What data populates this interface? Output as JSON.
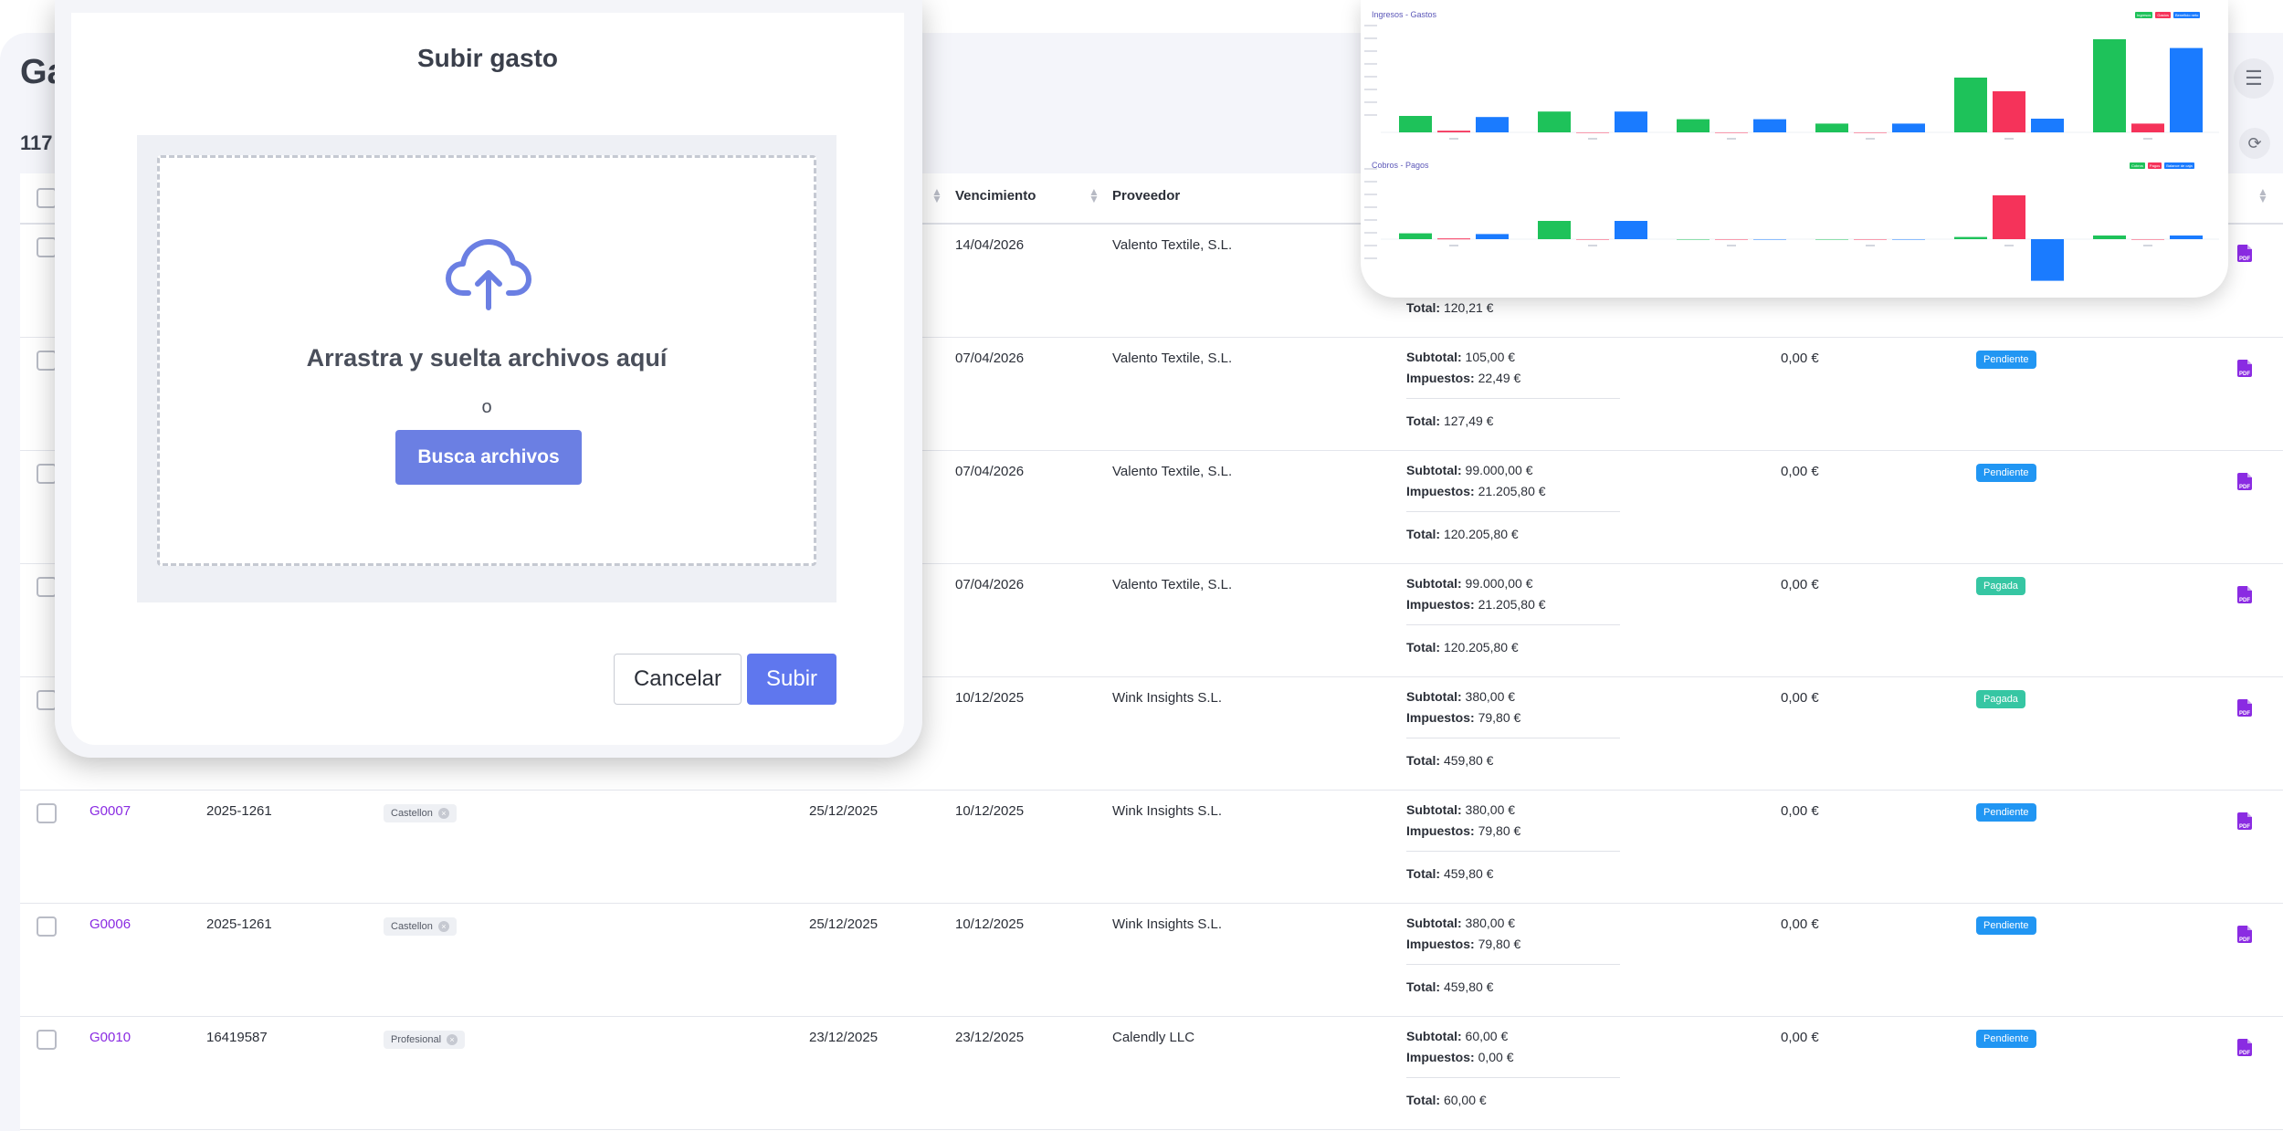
{
  "page": {
    "title": "Ga",
    "count": "117"
  },
  "table": {
    "headers": {
      "vencimiento": "Vencimiento",
      "proveedor": "Proveedor"
    },
    "rows": [
      {
        "code": "",
        "num": "",
        "tag": "",
        "fecha": "",
        "venc": "14/04/2026",
        "prov": "Valento Textile, S.L.",
        "subtotal": "",
        "impuestos": "",
        "total": "120,21 €",
        "pagado": "",
        "estado": "",
        "estado_type": ""
      },
      {
        "code": "",
        "num": "",
        "tag": "",
        "fecha": "",
        "venc": "07/04/2026",
        "prov": "Valento Textile, S.L.",
        "subtotal": "105,00 €",
        "impuestos": "22,49 €",
        "total": "127,49 €",
        "pagado": "0,00 €",
        "estado": "Pendiente",
        "estado_type": "pend"
      },
      {
        "code": "",
        "num": "",
        "tag": "",
        "fecha": "",
        "venc": "07/04/2026",
        "prov": "Valento Textile, S.L.",
        "subtotal": "99.000,00 €",
        "impuestos": "21.205,80 €",
        "total": "120.205,80 €",
        "pagado": "0,00 €",
        "estado": "Pendiente",
        "estado_type": "pend"
      },
      {
        "code": "",
        "num": "",
        "tag": "",
        "fecha": "",
        "venc": "07/04/2026",
        "prov": "Valento Textile, S.L.",
        "subtotal": "99.000,00 €",
        "impuestos": "21.205,80 €",
        "total": "120.205,80 €",
        "pagado": "0,00 €",
        "estado": "Pagada",
        "estado_type": "paid"
      },
      {
        "code": "",
        "num": "",
        "tag": "",
        "fecha": "",
        "venc": "10/12/2025",
        "prov": "Wink Insights S.L.",
        "subtotal": "380,00 €",
        "impuestos": "79,80 €",
        "total": "459,80 €",
        "pagado": "0,00 €",
        "estado": "Pagada",
        "estado_type": "paid"
      },
      {
        "code": "G0007",
        "num": "2025-1261",
        "tag": "Castellon",
        "fecha": "25/12/2025",
        "venc": "10/12/2025",
        "prov": "Wink Insights S.L.",
        "subtotal": "380,00 €",
        "impuestos": "79,80 €",
        "total": "459,80 €",
        "pagado": "0,00 €",
        "estado": "Pendiente",
        "estado_type": "pend"
      },
      {
        "code": "G0006",
        "num": "2025-1261",
        "tag": "Castellon",
        "fecha": "25/12/2025",
        "venc": "10/12/2025",
        "prov": "Wink Insights S.L.",
        "subtotal": "380,00 €",
        "impuestos": "79,80 €",
        "total": "459,80 €",
        "pagado": "0,00 €",
        "estado": "Pendiente",
        "estado_type": "pend"
      },
      {
        "code": "G0010",
        "num": "16419587",
        "tag": "Profesional",
        "fecha": "23/12/2025",
        "venc": "23/12/2025",
        "prov": "Calendly LLC",
        "subtotal": "60,00 €",
        "impuestos": "0,00 €",
        "total": "60,00 €",
        "pagado": "0,00 €",
        "estado": "Pendiente",
        "estado_type": "pend"
      }
    ],
    "labels": {
      "subtotal": "Subtotal:",
      "impuestos": "Impuestos:",
      "total": "Total:",
      "pdf": "PDF"
    }
  },
  "modal": {
    "title": "Subir gasto",
    "drop_text": "Arrastra y suelta archivos aquí",
    "or_text": "o",
    "browse_label": "Busca archivos",
    "cancel_label": "Cancelar",
    "submit_label": "Subir"
  },
  "colors": {
    "green": "#1ec25a",
    "red": "#f5335a",
    "blue": "#1a7bff",
    "accent": "#6b7fe3"
  },
  "chart_data": [
    {
      "type": "bar",
      "title": "Ingresos - Gastos",
      "legend": [
        "Ingresos",
        "Gastos",
        "Beneficio neto"
      ],
      "series": [
        {
          "name": "Ingresos",
          "values": [
            30,
            38,
            24,
            16,
            100,
            170
          ]
        },
        {
          "name": "Gastos",
          "values": [
            3,
            0,
            0,
            0,
            75,
            16
          ]
        },
        {
          "name": "Beneficio neto",
          "values": [
            28,
            38,
            24,
            16,
            25,
            154
          ]
        }
      ]
    },
    {
      "type": "bar",
      "title": "Cobros - Pagos",
      "legend": [
        "Cobros",
        "Pagos",
        "Balance de caja"
      ],
      "series": [
        {
          "name": "Cobros",
          "values": [
            8,
            25,
            0,
            0,
            3,
            5
          ]
        },
        {
          "name": "Pagos",
          "values": [
            1,
            0,
            0,
            0,
            60,
            0
          ]
        },
        {
          "name": "Balance de caja",
          "values": [
            7,
            25,
            0,
            0,
            -57,
            5
          ]
        }
      ]
    }
  ]
}
